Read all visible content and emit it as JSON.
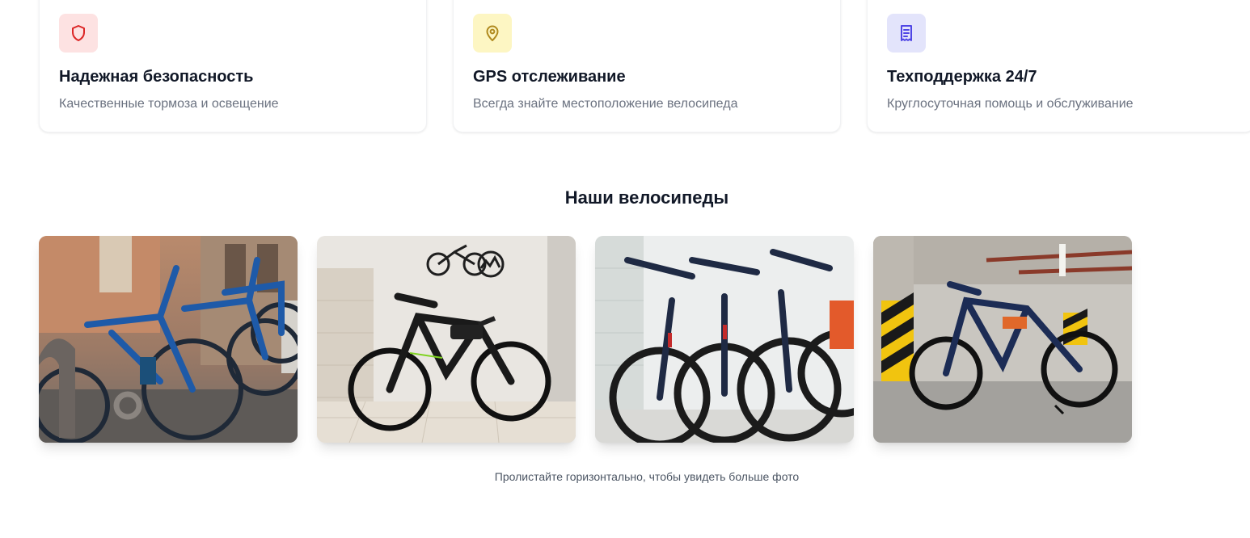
{
  "features": [
    {
      "icon": "shield-icon",
      "color": "#dc2626",
      "bg": "#fde2e2",
      "title": "Надежная безопасность",
      "desc": "Качественные тормоза и освещение"
    },
    {
      "icon": "map-pin-icon",
      "color": "#b08a1e",
      "bg": "#fdf6c3",
      "title": "GPS отслеживание",
      "desc": "Всегда знайте местоположение велосипеда"
    },
    {
      "icon": "receipt-icon",
      "color": "#4f46e5",
      "bg": "#e3e4fb",
      "title": "Техподдержка 24/7",
      "desc": "Круглосуточная помощь и обслуживание"
    }
  ],
  "gallery": {
    "title": "Наши велосипеды",
    "hint": "Пролистайте горизонтально, чтобы увидеть больше фото",
    "photos": [
      {
        "name": "bike-photo-street"
      },
      {
        "name": "bike-photo-wall-logo"
      },
      {
        "name": "bike-photo-row"
      },
      {
        "name": "bike-photo-parking"
      }
    ]
  }
}
